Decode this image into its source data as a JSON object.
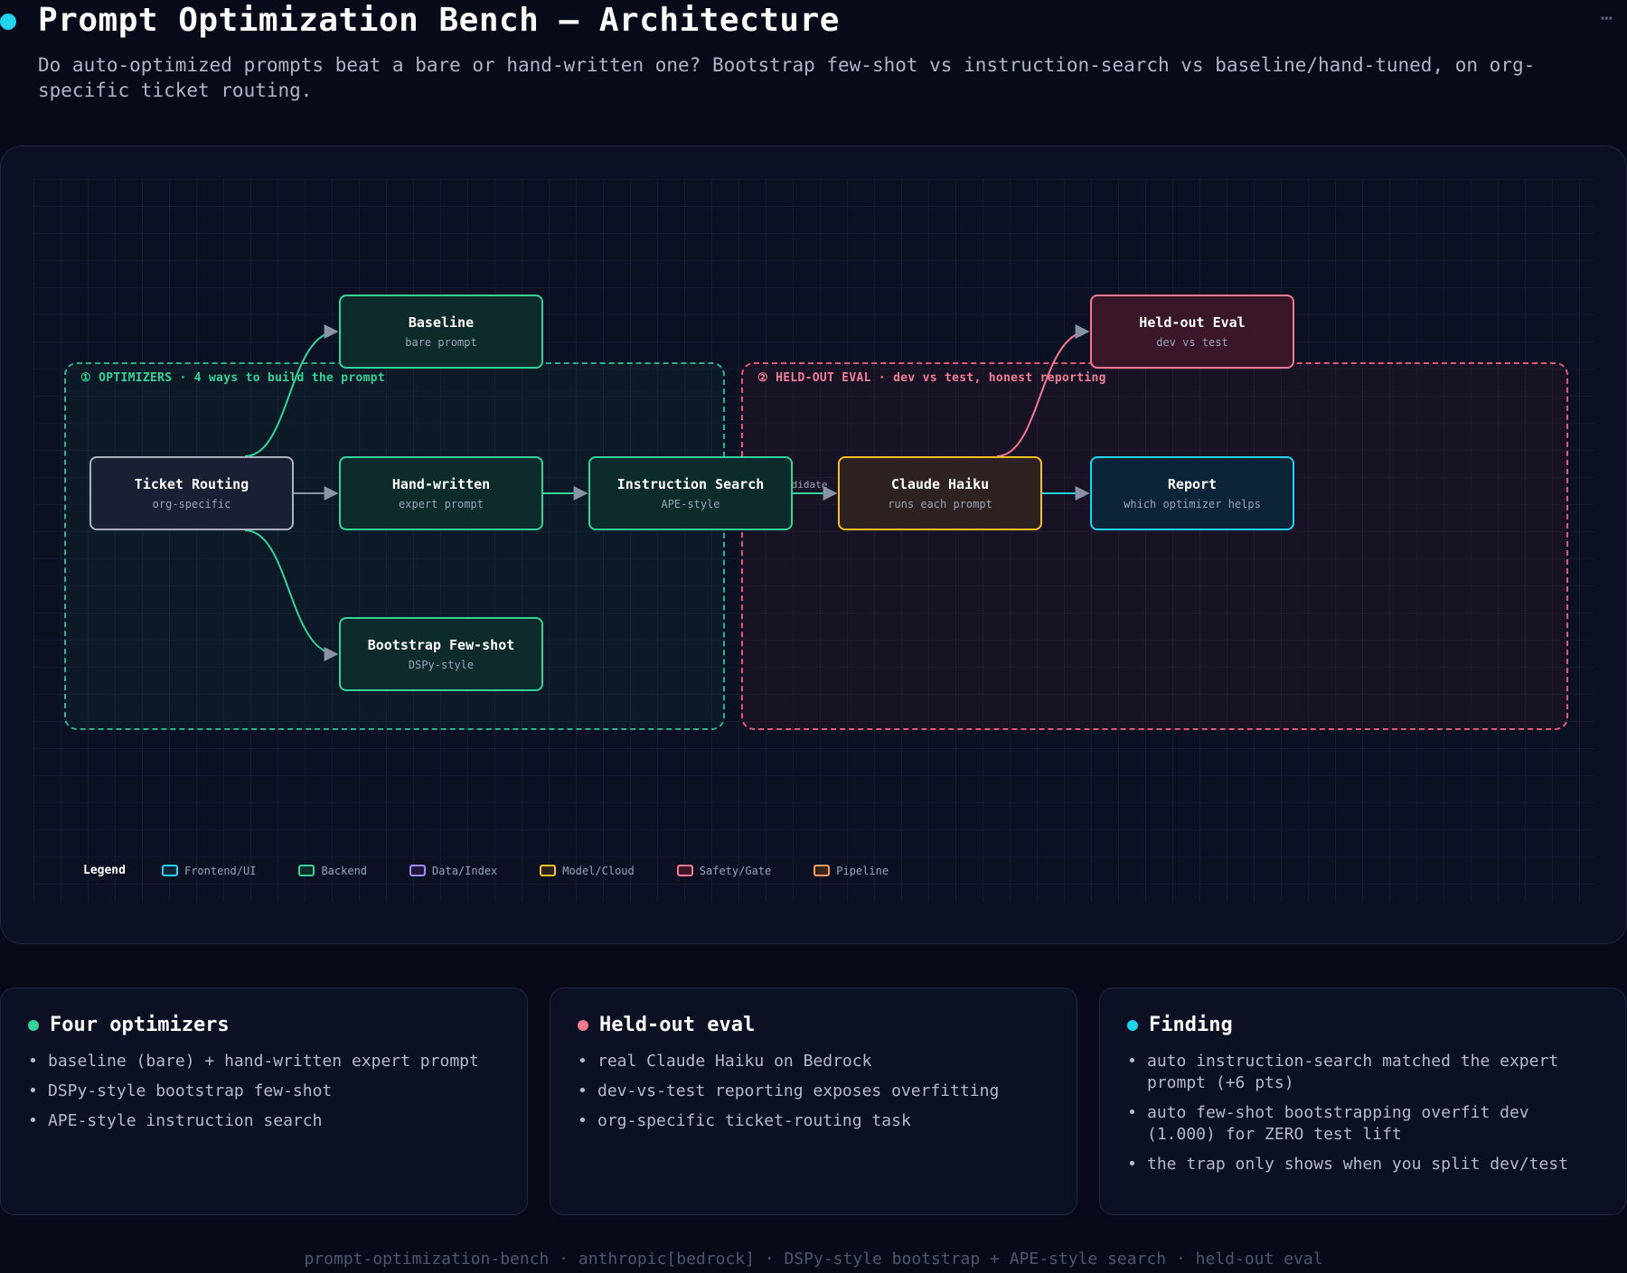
{
  "header": {
    "title": "Prompt Optimization Bench — Architecture",
    "subtitle": "Do auto-optimized prompts beat a bare or hand-written one? Bootstrap few-shot vs instruction-search vs baseline/hand-tuned, on org-specific ticket routing.",
    "menu_icon": "more-horizontal-icon",
    "title_dot_color": "#22d3ee"
  },
  "diagram": {
    "groups": {
      "optimizers": {
        "label": "① OPTIMIZERS · 4 ways to build the prompt",
        "color": "#34d399"
      },
      "eval": {
        "label": "② HELD-OUT EVAL · dev vs test, honest reporting",
        "color": "#f07e98"
      }
    },
    "nodes": {
      "ticket": {
        "title": "Ticket Routing",
        "sub": "org-specific"
      },
      "baseline": {
        "title": "Baseline",
        "sub": "bare prompt"
      },
      "handwritten": {
        "title": "Hand-written",
        "sub": "expert prompt"
      },
      "bootstrap": {
        "title": "Bootstrap Few-shot",
        "sub": "DSPy-style"
      },
      "instruction": {
        "title": "Instruction Search",
        "sub": "APE-style"
      },
      "haiku": {
        "title": "Claude Haiku",
        "sub": "runs each prompt"
      },
      "heldout": {
        "title": "Held-out Eval",
        "sub": "dev vs test"
      },
      "report": {
        "title": "Report",
        "sub": "which optimizer helps"
      }
    },
    "edges": [
      {
        "from": "ticket",
        "to": "baseline"
      },
      {
        "from": "ticket",
        "to": "handwritten"
      },
      {
        "from": "ticket",
        "to": "bootstrap"
      },
      {
        "from": "handwritten",
        "to": "instruction"
      },
      {
        "from": "instruction",
        "to": "haiku",
        "label": "candidates"
      },
      {
        "from": "haiku",
        "to": "heldout"
      },
      {
        "from": "haiku",
        "to": "report"
      }
    ],
    "edge_label_visible": "ndidate",
    "legend": {
      "title": "Legend",
      "items": [
        {
          "label": "Frontend/UI",
          "color": "#22d3ee"
        },
        {
          "label": "Backend",
          "color": "#34d399"
        },
        {
          "label": "Data/Index",
          "color": "#a78bfa"
        },
        {
          "label": "Model/Cloud",
          "color": "#fbbf24"
        },
        {
          "label": "Safety/Gate",
          "color": "#f47a93"
        },
        {
          "label": "Pipeline",
          "color": "#f59e6b"
        }
      ]
    }
  },
  "cards": [
    {
      "title": "Four optimizers",
      "dot_color": "#34d399",
      "bullets": [
        "baseline (bare) + hand-written expert prompt",
        "DSPy-style bootstrap few-shot",
        "APE-style instruction search"
      ]
    },
    {
      "title": "Held-out eval",
      "dot_color": "#f47a93",
      "bullets": [
        "real Claude Haiku on Bedrock",
        "dev-vs-test reporting exposes overfitting",
        "org-specific ticket-routing task"
      ]
    },
    {
      "title": "Finding",
      "dot_color": "#22d3ee",
      "bullets": [
        "auto instruction-search matched the expert prompt (+6 pts)",
        "auto few-shot bootstrapping overfit dev (1.000) for ZERO test lift",
        "the trap only shows when you split dev/test"
      ]
    }
  ],
  "footer": "prompt-optimization-bench · anthropic[bedrock] · DSPy-style bootstrap + APE-style search · held-out eval"
}
